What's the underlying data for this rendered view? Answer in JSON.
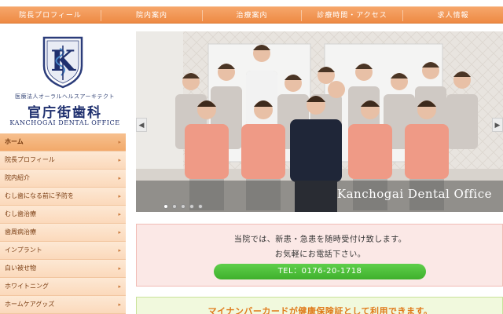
{
  "topnav": {
    "items": [
      {
        "label": "院長プロフィール"
      },
      {
        "label": "院内案内"
      },
      {
        "label": "治療案内"
      },
      {
        "label": "診療時間・アクセス"
      },
      {
        "label": "求人情報"
      }
    ]
  },
  "logo": {
    "emblem_letter": "K",
    "corporation": "医療法人オーラルヘルスアーキテクト",
    "name": "官庁街歯科",
    "name_en": "KANCHOGAI DENTAL OFFICE"
  },
  "sidenav": {
    "items": [
      {
        "label": "ホーム"
      },
      {
        "label": "院長プロフィール"
      },
      {
        "label": "院内紹介"
      },
      {
        "label": "むし歯になる前に予防を"
      },
      {
        "label": "むし歯治療"
      },
      {
        "label": "歯周病治療"
      },
      {
        "label": "インプラント"
      },
      {
        "label": "白い被せ物"
      },
      {
        "label": "ホワイトニング"
      },
      {
        "label": "ホームケアグッズ"
      }
    ],
    "arrow": "▸"
  },
  "hero": {
    "caption": "Kanchogai Dental Office",
    "dot_count": 5,
    "active_dot": 0,
    "prev_glyph": "◀",
    "next_glyph": "▶"
  },
  "notice": {
    "line1": "当院では、新患・急患を随時受付け致します。",
    "line2": "お気軽にお電話下さい。",
    "tel_label": "TEL：0176-20-1718"
  },
  "mynumber": {
    "text": "マイナンバーカードが健康保険証として利用できます。"
  },
  "colors": {
    "nav_orange": "#ee8a44",
    "sidenav_peach": "#fbd9bb",
    "logo_navy": "#1e2f6e",
    "tel_green": "#3fb02c",
    "notice_pink": "#fbe8e6"
  }
}
